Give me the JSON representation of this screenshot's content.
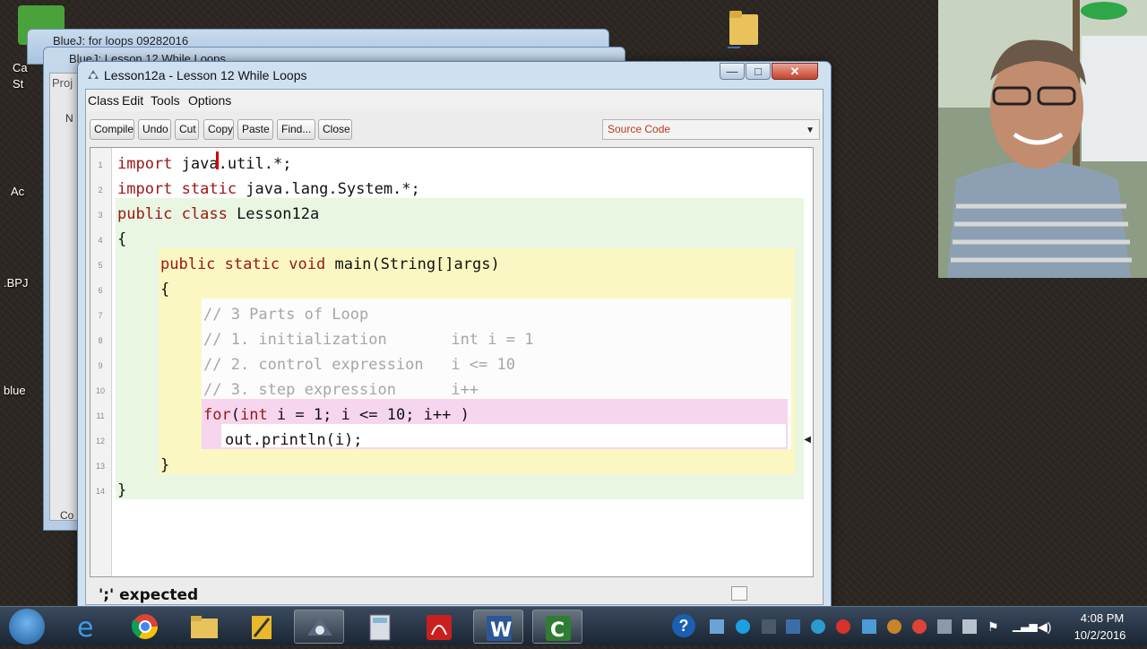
{
  "desktop": {
    "icon_labels": [
      "Ca",
      "St",
      "Ac",
      ".BPJ",
      "blue"
    ]
  },
  "background_windows": [
    {
      "title": "BlueJ:  for loops 09282016"
    },
    {
      "title": "BlueJ:  Lesson 12 While Loops"
    }
  ],
  "background_fragments": [
    "Proj",
    "N",
    "Co"
  ],
  "window": {
    "title": "Lesson12a - Lesson 12 While Loops",
    "minimize": "—",
    "maximize": "□",
    "close": "✕"
  },
  "menu": [
    "Class",
    "Edit",
    "Tools",
    "Options"
  ],
  "toolbar": {
    "compile": "Compile",
    "undo": "Undo",
    "cut": "Cut",
    "copy": "Copy",
    "paste": "Paste",
    "find": "Find...",
    "close": "Close",
    "view_mode": "Source Code"
  },
  "editor": {
    "line_numbers": [
      "1",
      "2",
      "3",
      "4",
      "5",
      "6",
      "7",
      "8",
      "9",
      "10",
      "11",
      "12",
      "13",
      "14"
    ],
    "lines": [
      {
        "kw": "import",
        "rest": " java.util.*;"
      },
      {
        "kw": "import static",
        "rest": " java.lang.System.*;"
      },
      {
        "kw": "public class",
        "rest": " Lesson12a"
      },
      {
        "kw": "",
        "rest": "{"
      },
      {
        "kw": "public static void",
        "rest": " main(String[]args)"
      },
      {
        "kw": "",
        "rest": "{"
      },
      {
        "comment": "// 3 Parts of Loop"
      },
      {
        "comment": "// 1. initialization       int i = 1"
      },
      {
        "comment": "// 2. control expression   i <= 10"
      },
      {
        "comment": "// 3. step expression      i++"
      },
      {
        "kw": "for",
        "rest": "(",
        "kw2": "int",
        "rest2": " i = 1; i <= 10; i++ )"
      },
      {
        "kw": "",
        "rest": "out.println(i);"
      },
      {
        "kw": "",
        "rest": "}"
      },
      {
        "kw": "",
        "rest": "}"
      }
    ]
  },
  "status": {
    "message": "';' expected"
  },
  "taskbar": {
    "time": "4:08 PM",
    "date": "10/2/2016"
  },
  "colors": {
    "keyword": "#9c1512",
    "comment": "#a6a6a6",
    "class_scope": "#e8f6e2",
    "method_scope": "#fbf7c2",
    "body_scope": "#fcfcfc",
    "loop_scope": "#f6d6ee"
  }
}
